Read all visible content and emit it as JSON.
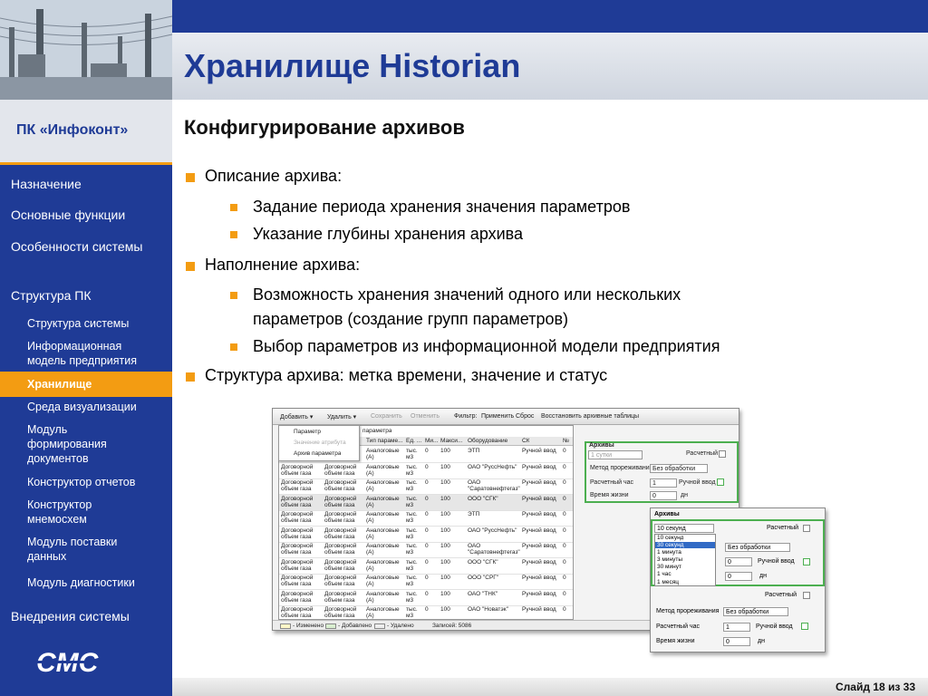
{
  "title": "Хранилище Historian",
  "brand": "ПК «Инфоконт»",
  "subtitle": "Конфигурирование архивов",
  "nav": [
    {
      "label": "Назначение",
      "level": 1
    },
    {
      "label": "Основные функции",
      "level": 1
    },
    {
      "label": "Особенности системы",
      "level": 1
    },
    {
      "label": "Структура ПК",
      "level": 1
    },
    {
      "label": "Структура системы",
      "level": 2
    },
    {
      "label": "Информационная модель предприятия",
      "level": 2
    },
    {
      "label": "Хранилище",
      "level": 2,
      "active": true
    },
    {
      "label": "Среда визуализации",
      "level": 2
    },
    {
      "label": "Модуль формирования документов",
      "level": 2
    },
    {
      "label": "Конструктор отчетов",
      "level": 2
    },
    {
      "label": "Конструктор мнемосхем",
      "level": 2
    },
    {
      "label": "Модуль поставки данных",
      "level": 2
    },
    {
      "label": "Модуль диагностики",
      "level": 2
    },
    {
      "label": "Внедрения системы",
      "level": 1
    }
  ],
  "logo_text": "СМС",
  "bullets": {
    "b1": "Описание архива:",
    "b1a": "Задание периода хранения значения параметров",
    "b1b": "Указание глубины хранения архива",
    "b2": "Наполнение архива:",
    "b2a1": "Возможность хранения значений одного или нескольких",
    "b2a2": "параметров (создание групп параметров)",
    "b2b": "Выбор параметров из информационной модели предприятия",
    "b3": "Структура архива: метка времени, значение и статус"
  },
  "footer": "Слайд 18 из 33",
  "app": {
    "toolbar": [
      "Добавить ▾",
      "Удалить ▾",
      "Сохранить",
      "Отменить",
      "Фильтр:",
      "Применить",
      "Сброс",
      "Восстановить архивные таблицы"
    ],
    "menu": [
      "Параметр",
      "Значение атрибута",
      "Архив параметра"
    ],
    "tab": "параметра",
    "columns": [
      "Тип параме...",
      "Ед. ...",
      "Ми...",
      "Макси...",
      "Оборудование",
      "СК",
      "№"
    ],
    "rows": [
      [
        "",
        "",
        "Аналоговые (А)",
        "тыс. м3",
        "0",
        "100",
        "ЭТП",
        "Ручной ввод",
        "0"
      ],
      [
        "Договорной объем газа",
        "Договорной объем газа",
        "Аналоговые (А)",
        "тыс. м3",
        "0",
        "100",
        "ОАО \"РуссНефть\"",
        "Ручной ввод",
        "0"
      ],
      [
        "Договорной объем газа",
        "Договорной объем газа",
        "Аналоговые (А)",
        "тыс. м3",
        "0",
        "100",
        "ОАО \"Саратовнефтегаз\"",
        "Ручной ввод",
        "0"
      ],
      [
        "Договорной объем газа",
        "Договорной объем газа",
        "Аналоговые (А)",
        "тыс. м3",
        "0",
        "100",
        "ООО \"СГК\"",
        "Ручной ввод",
        "0"
      ],
      [
        "Договорной объем газа",
        "Договорной объем газа",
        "Аналоговые (А)",
        "тыс. м3",
        "0",
        "100",
        "ЭТП",
        "Ручной ввод",
        "0"
      ],
      [
        "Договорной объем газа",
        "Договорной объем газа",
        "Аналоговые (А)",
        "тыс. м3",
        "0",
        "100",
        "ОАО \"РуссНефть\"",
        "Ручной ввод",
        "0"
      ],
      [
        "Договорной объем газа",
        "Договорной объем газа",
        "Аналоговые (А)",
        "тыс. м3",
        "0",
        "100",
        "ОАО \"Саратовнефтегаз\"",
        "Ручной ввод",
        "0"
      ],
      [
        "Договорной объем газа",
        "Договорной объем газа",
        "Аналоговые (А)",
        "тыс. м3",
        "0",
        "100",
        "ООО \"СГК\"",
        "Ручной ввод",
        "0"
      ],
      [
        "Договорной объем газа",
        "Договорной объем газа",
        "Аналоговые (А)",
        "тыс. м3",
        "0",
        "100",
        "ООО \"СРГ\"",
        "Ручной ввод",
        "0"
      ],
      [
        "Договорной объем газа",
        "Договорной объем газа",
        "Аналоговые (А)",
        "тыс. м3",
        "0",
        "100",
        "ОАО \"ТНК\"",
        "Ручной ввод",
        "0"
      ],
      [
        "Договорной объем газа",
        "Договорной объем газа",
        "Аналоговые (А)",
        "тыс. м3",
        "0",
        "100",
        "ОАО \"Новатэк\"",
        "Ручной ввод",
        "0"
      ]
    ],
    "status": [
      "- Изменено",
      "- Добавлено",
      "- Удалено",
      "Записей: 5086"
    ],
    "panel1": {
      "title": "Архивы",
      "period": "1 сутки",
      "calc_label": "Расчетный",
      "method_label": "Метод прореживания",
      "method_value": "Без обработки",
      "hour_label": "Расчетный час",
      "hour_value": "1",
      "manual_label": "Ручной ввод",
      "life_label": "Время жизни",
      "life_value": "0",
      "life_unit": "дн"
    },
    "panel2": {
      "title": "Архивы",
      "period": "10 секунд",
      "calc_label": "Расчетный",
      "options": [
        "10 секунд",
        "30 секунд",
        "1 минута",
        "3 минуты",
        "30 минут",
        "1 час",
        "1 месяц"
      ],
      "method_value": "Без обработки",
      "hour_value": "0",
      "manual_label": "Ручной ввод",
      "life_value": "0",
      "life_unit": "дн",
      "calc2_label": "Расчетный",
      "method_label": "Метод прореживания",
      "method2_value": "Без обработки",
      "hour_label": "Расчетный час",
      "hour2_value": "1",
      "life_label": "Время жизни",
      "life2_value": "0"
    }
  }
}
